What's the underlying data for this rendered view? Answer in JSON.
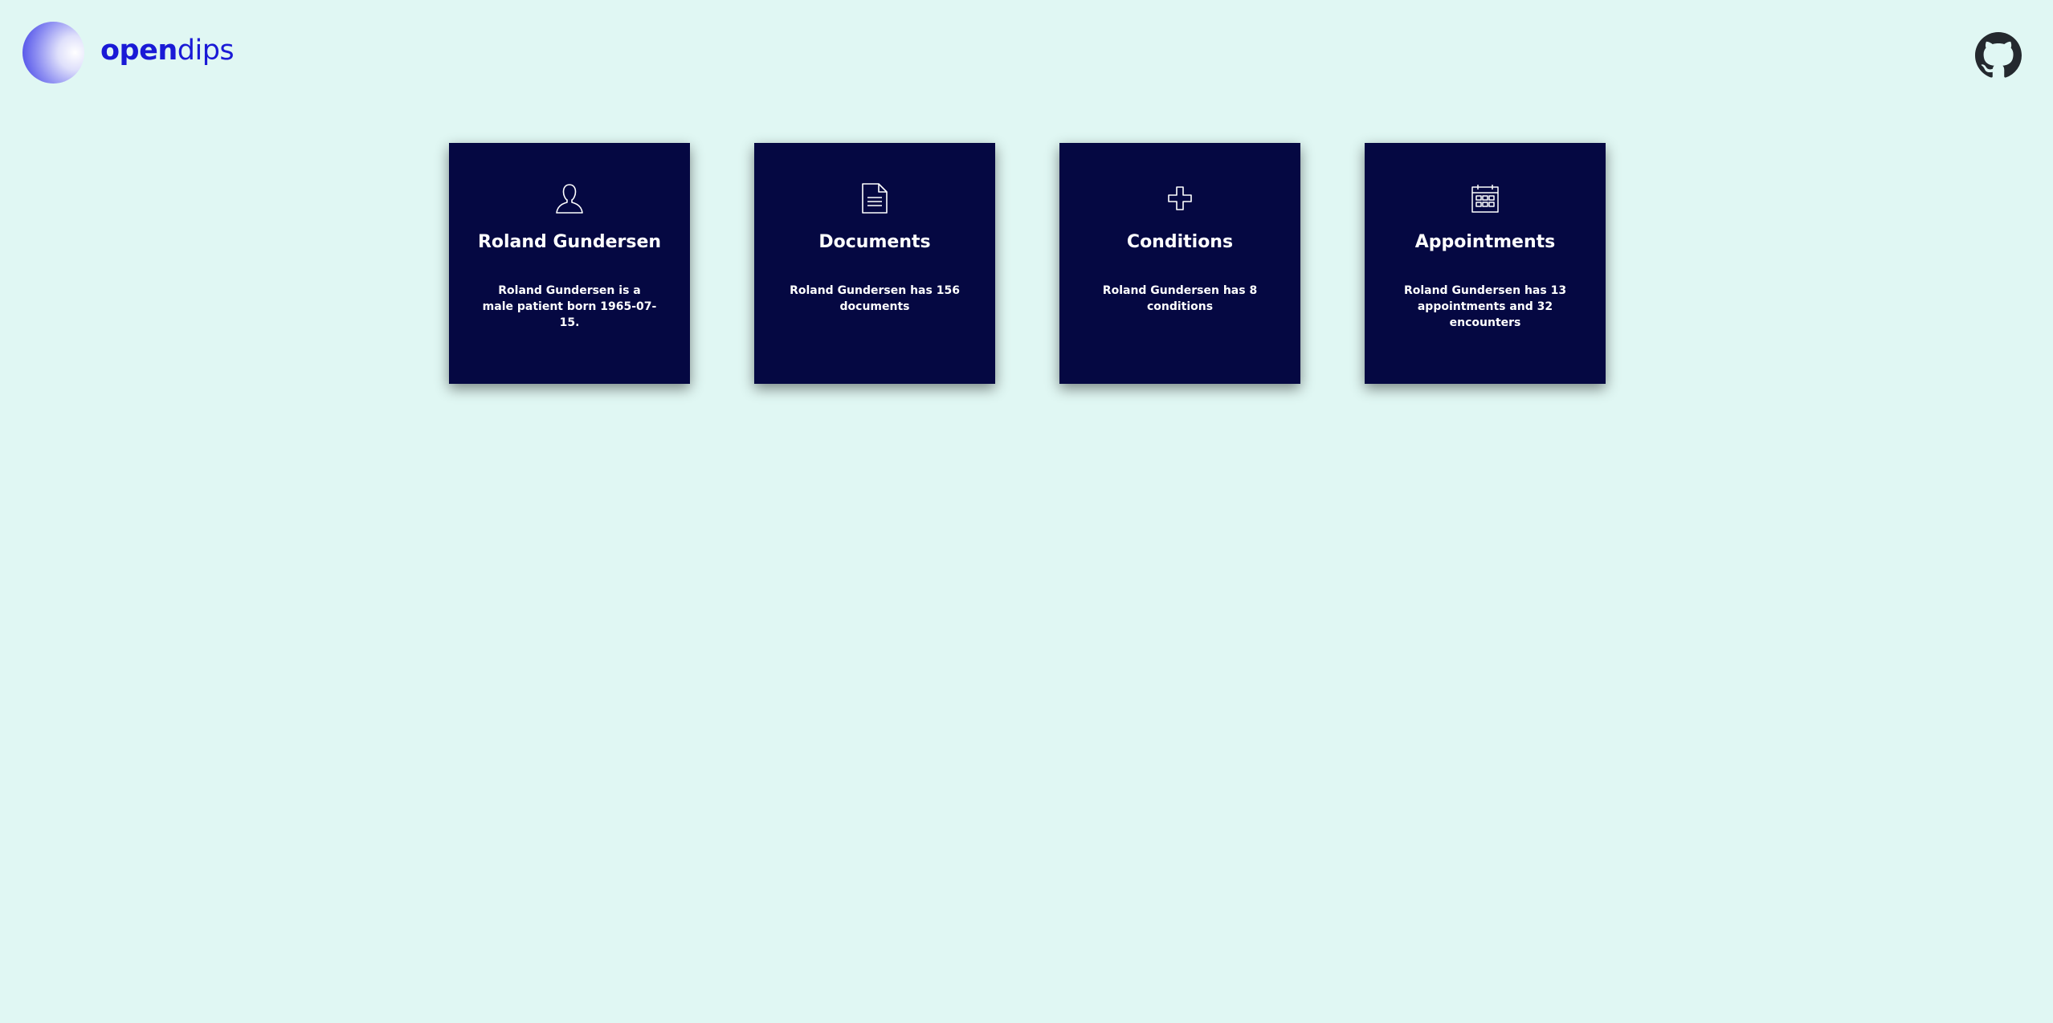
{
  "header": {
    "logo": {
      "text_strong": "open",
      "text_light": "dips",
      "icon": "opendips-logo-circle"
    },
    "github": {
      "icon": "github-icon"
    }
  },
  "cards": [
    {
      "icon": "person-icon",
      "title": "Roland Gundersen",
      "description": "Roland Gundersen is a male patient born 1965-07-15."
    },
    {
      "icon": "document-icon",
      "title": "Documents",
      "description": "Roland Gundersen has 156 documents"
    },
    {
      "icon": "medical-cross-icon",
      "title": "Conditions",
      "description": "Roland Gundersen has 8 conditions"
    },
    {
      "icon": "calendar-icon",
      "title": "Appointments",
      "description": "Roland Gundersen has 13 appointments and 32 encounters"
    }
  ],
  "colors": {
    "background": "#e0f7f3",
    "card": "#050842",
    "brand": "#1a1ad6",
    "card_text": "#ffffff",
    "github_icon": "#24292e"
  }
}
